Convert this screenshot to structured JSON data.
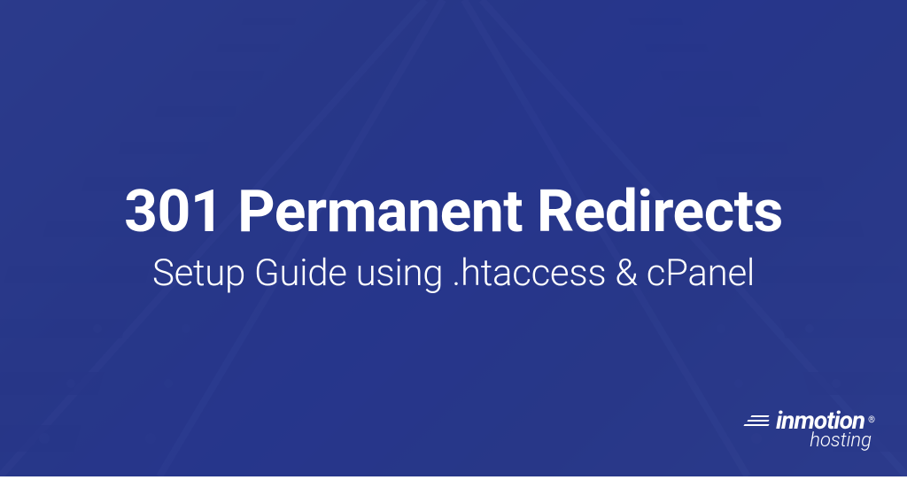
{
  "hero": {
    "heading": "301 Permanent Redirects",
    "subheading": "Setup Guide using .htaccess & cPanel"
  },
  "logo": {
    "brand": "inmotion",
    "registered": "®",
    "sub": "hosting"
  },
  "colors": {
    "overlay": "#23338a",
    "text": "#ffffff"
  }
}
